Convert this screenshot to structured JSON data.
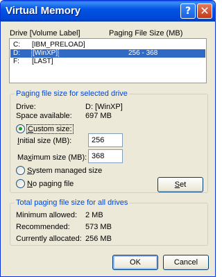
{
  "window": {
    "title": "Virtual Memory",
    "help_glyph": "?",
    "close_glyph": "✕"
  },
  "drive_list": {
    "header_drive": "Drive [Volume Label]",
    "header_size": "Paging File Size (MB)",
    "rows": [
      {
        "drive": "C:",
        "label": "[IBM_PRELOAD]",
        "size": "",
        "selected": false
      },
      {
        "drive": "D:",
        "label": "[WinXP]",
        "size": "256 - 368",
        "selected": true
      },
      {
        "drive": "F:",
        "label": "[LAST]",
        "size": "",
        "selected": false
      }
    ]
  },
  "selected_drive": {
    "group_title": "Paging file size for selected drive",
    "drive_label": "Drive:",
    "drive_value": "D:  [WinXP]",
    "space_label": "Space available:",
    "space_value": "697 MB",
    "custom_size": {
      "pre": "",
      "mnemonic": "C",
      "post": "ustom size:",
      "selected": true
    },
    "initial_size": {
      "pre": "",
      "mnemonic": "I",
      "post": "nitial size (MB):",
      "value": "256"
    },
    "maximum_size": {
      "pre": "Ma",
      "mnemonic": "x",
      "post": "imum size (MB):",
      "value": "368"
    },
    "system_managed": {
      "pre": "",
      "mnemonic": "S",
      "post": "ystem managed size",
      "selected": false
    },
    "no_paging": {
      "pre": "",
      "mnemonic": "N",
      "post": "o paging file",
      "selected": false
    },
    "set_button": {
      "pre": "",
      "mnemonic": "S",
      "post": "et"
    }
  },
  "totals": {
    "group_title": "Total paging file size for all drives",
    "min_label": "Minimum allowed:",
    "min_value": "2 MB",
    "rec_label": "Recommended:",
    "rec_value": "573 MB",
    "cur_label": "Currently allocated:",
    "cur_value": "256 MB"
  },
  "buttons": {
    "ok": "OK",
    "cancel": "Cancel"
  }
}
